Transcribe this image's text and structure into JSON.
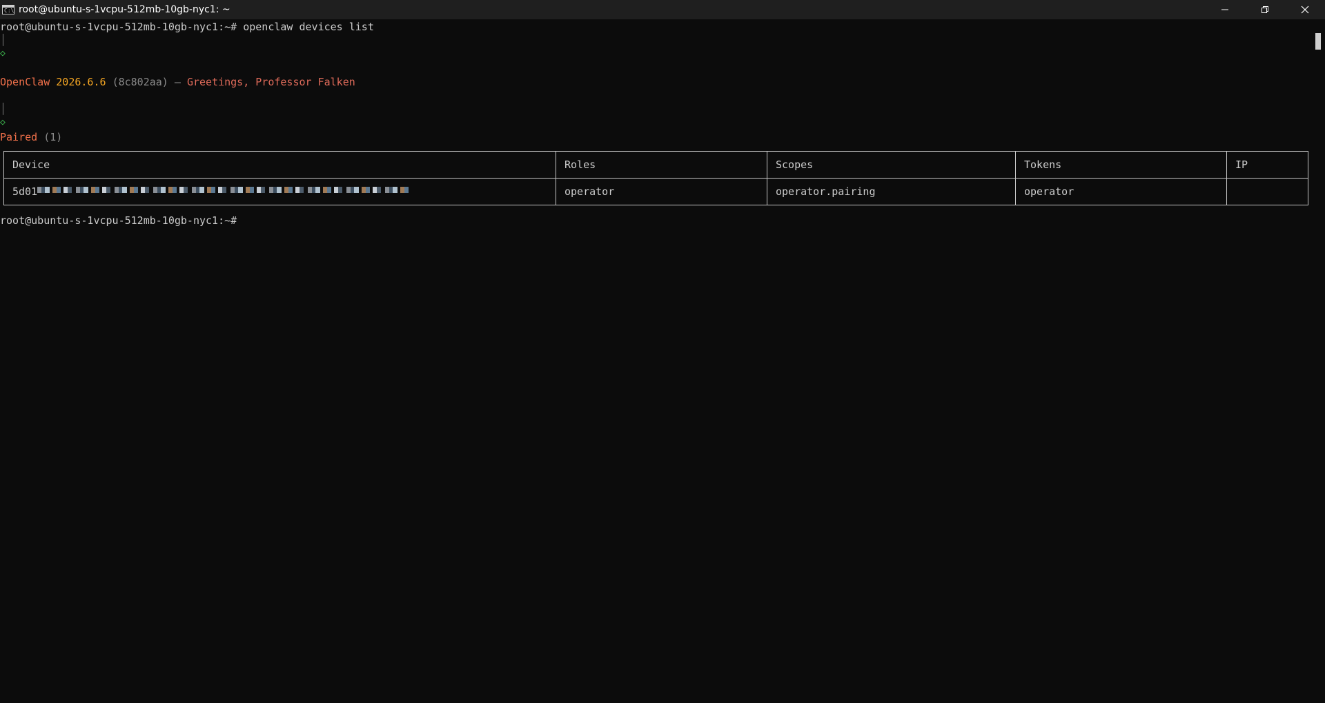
{
  "window": {
    "title": "root@ubuntu-s-1vcpu-512mb-10gb-nyc1: ~",
    "icon": "terminal-icon",
    "controls": {
      "minimize": "minimize-icon",
      "restore": "restore-icon",
      "close": "close-icon"
    }
  },
  "terminal": {
    "prompt": "root@ubuntu-s-1vcpu-512mb-10gb-nyc1:~#",
    "command": "openclaw devices list",
    "tree_bar": "│",
    "tree_node": "◇",
    "banner": {
      "name": "OpenClaw",
      "version": "2026.6.6",
      "commit": "(8c802aa)",
      "dash": "—",
      "greeting": "Greetings, Professor Falken"
    },
    "section": {
      "label": "Paired",
      "count": "(1)"
    },
    "table": {
      "headers": [
        "Device",
        "Roles",
        "Scopes",
        "Tokens",
        "IP"
      ],
      "rows": [
        {
          "device": "5d01",
          "roles": "operator",
          "scopes": "operator.pairing",
          "tokens": "operator",
          "ip": ""
        }
      ]
    },
    "final_prompt": "root@ubuntu-s-1vcpu-512mb-10gb-nyc1:~#"
  },
  "colors": {
    "background": "#0c0c0c",
    "titlebar": "#1f1f1f",
    "accent_orange": "#f0704a",
    "version_gold": "#f5a623",
    "node_green": "#3fb950"
  }
}
